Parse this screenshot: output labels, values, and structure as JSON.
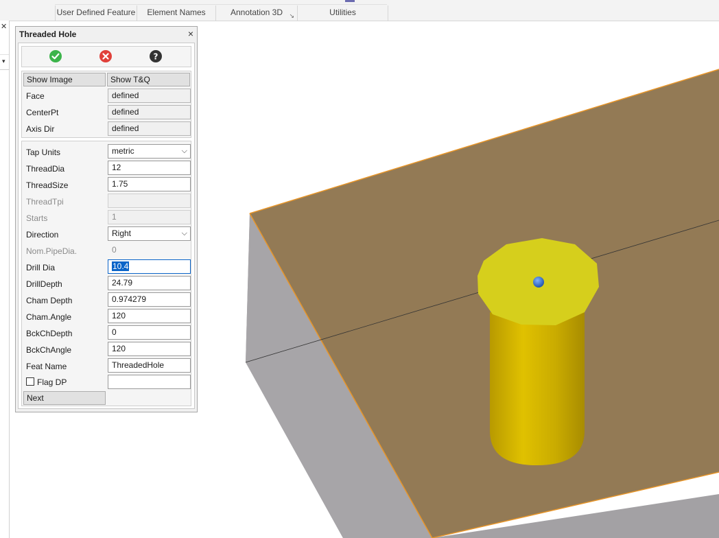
{
  "ribbon": {
    "groups": [
      "User Defined Feature",
      "Element Names",
      "Annotation 3D",
      "Utilities"
    ]
  },
  "dialog": {
    "title": "Threaded Hole",
    "close": "×",
    "icons": [
      "ok-icon",
      "cancel-icon",
      "help-icon"
    ],
    "show_image": "Show Image",
    "show_tq": "Show T&Q",
    "face_label": "Face",
    "face_value": "defined",
    "centerpt_label": "CenterPt",
    "centerpt_value": "defined",
    "axisdir_label": "Axis Dir",
    "axisdir_value": "defined",
    "tap_units_label": "Tap Units",
    "tap_units_value": "metric",
    "threaddia_label": "ThreadDia",
    "threaddia_value": "12",
    "threadsize_label": "ThreadSize",
    "threadsize_value": "1.75",
    "threadtpi_label": "ThreadTpi",
    "threadtpi_value": "",
    "starts_label": "Starts",
    "starts_value": "1",
    "direction_label": "Direction",
    "direction_value": "Right",
    "nompipedia_label": "Nom.PipeDia.",
    "nompipedia_value": "0",
    "drilldia_label": "Drill Dia",
    "drilldia_value": "10.4",
    "drilldepth_label": "DrillDepth",
    "drilldepth_value": "24.79",
    "chamdepth_label": "Cham Depth",
    "chamdepth_value": "0.974279",
    "chamangle_label": "Cham.Angle",
    "chamangle_value": "120",
    "bckchdepth_label": "BckChDepth",
    "bckchdepth_value": "0",
    "bckchangle_label": "BckChAngle",
    "bckchangle_value": "120",
    "featname_label": "Feat Name",
    "featname_value": "ThreadedHole",
    "flagdp_label": "Flag DP",
    "flagdp_value": "",
    "next": "Next"
  },
  "colors": {
    "ok": "#3cb44b",
    "cancel": "#e0403a",
    "help": "#333333",
    "block_top": "#937a55",
    "block_side": "#a3a1a4",
    "cylinder": "#d1b700",
    "cap": "#d6cf1c",
    "point": "#1e5fc0"
  }
}
